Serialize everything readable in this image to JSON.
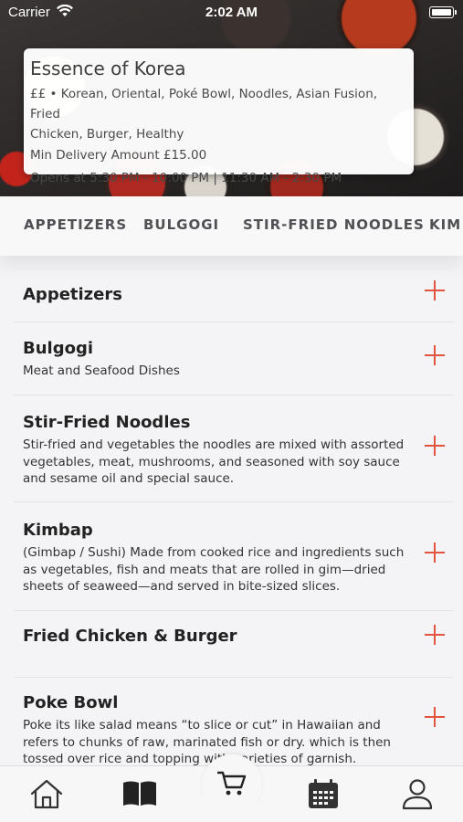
{
  "status_bar": {
    "carrier": "Carrier",
    "time": "2:02 AM"
  },
  "restaurant": {
    "name": "Essence of Korea",
    "cuisines_line1": "££ • Korean, Oriental, Poké Bowl, Noodles, Asian Fusion, Fried",
    "cuisines_line2": "Chicken, Burger, Healthy",
    "min_delivery": "Min Delivery Amount £15.00",
    "opening_hours": "Opens at 5:30 PM - 10:00 PM | 11:30 AM - 2:30 PM"
  },
  "category_tabs": [
    "APPETIZERS",
    "BULGOGI",
    "STIR-FRIED NOODLES",
    "KIM"
  ],
  "menu": {
    "items": [
      {
        "title": "Appetizers",
        "desc": ""
      },
      {
        "title": "Bulgogi",
        "desc": "Meat and Seafood Dishes"
      },
      {
        "title": "Stir-Fried Noodles",
        "desc": "Stir-fried and vegetables the noodles are mixed with assorted vegetables, meat, mushrooms, and seasoned with soy sauce and sesame oil and special sauce."
      },
      {
        "title": "Kimbap",
        "desc": "(Gimbap / Sushi) Made from cooked rice and ingredients such as vegetables, fish and meats that are rolled in gim—dried sheets of seaweed—and served in bite-sized slices."
      },
      {
        "title": "Fried Chicken & Burger",
        "desc": ""
      },
      {
        "title": "Poke Bowl",
        "desc": "Poke its like salad means “to slice or cut” in Hawaiian and refers to chunks of raw, marinated fish or dry. which is then tossed over rice and topping with varieties of garnish."
      }
    ]
  },
  "bottom_nav": {
    "items": [
      "home-icon",
      "menu-book-icon",
      "cart-icon",
      "calendar-icon",
      "profile-icon"
    ]
  },
  "colors": {
    "accent": "#e2543f",
    "background": "#f4f4f6"
  }
}
